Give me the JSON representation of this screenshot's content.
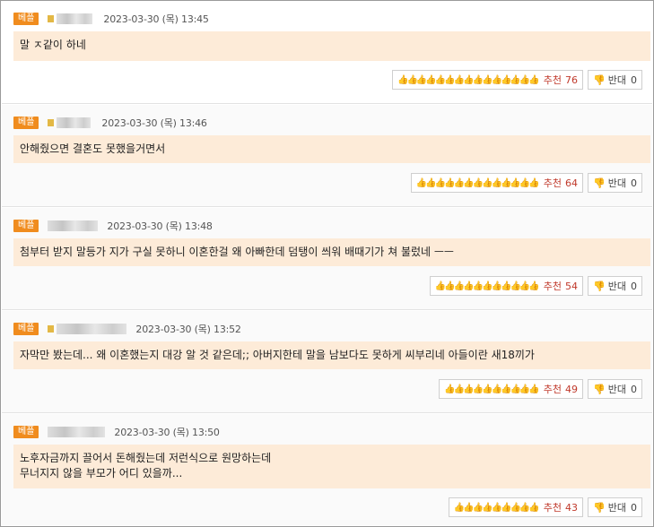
{
  "badge_label": "베플",
  "up_label": "추천",
  "down_label": "반대",
  "thumb_glyphs": {
    "c1": "👍👍👍👍👍👍👍👍👍👍👍👍👍👍👍",
    "c2": "👍👍👍👍👍👍👍👍👍👍👍👍👍",
    "c3": "👍👍👍👍👍👍👍👍👍👍👍",
    "c4": "👍👍👍👍👍👍👍👍👍👍",
    "c5": "👍👍👍👍👍👍👍👍👍"
  },
  "comments": [
    {
      "date": "2023-03-30 (목) 13:45",
      "text_lines": [
        "말 ㅈ같이 하네"
      ],
      "up": "76",
      "down": "0"
    },
    {
      "date": "2023-03-30 (목) 13:46",
      "text_lines": [
        "안해줬으면 결혼도 못했을거면서"
      ],
      "up": "64",
      "down": "0"
    },
    {
      "date": "2023-03-30 (목) 13:48",
      "text_lines": [
        "첨부터 받지 말등가 지가 구실 못하니 이혼한걸 왜 아빠한데 덤탱이 씌워 배때기가 쳐 불렀네 ㅡㅡ"
      ],
      "up": "54",
      "down": "0"
    },
    {
      "date": "2023-03-30 (목) 13:52",
      "text_lines": [
        "자막만 봤는데... 왜 이혼했는지 대강 알 것 같은데;; 아버지한테 말을 남보다도 못하게 씨부리네 아들이란 새18끼가"
      ],
      "up": "49",
      "down": "0"
    },
    {
      "date": "2023-03-30 (목) 13:50",
      "text_lines": [
        "노후자금까지 끌어서 돈해줬는데 저런식으로 원망하는데",
        "무너지지 않을 부모가 어디 있을까..."
      ],
      "up": "43",
      "down": "0"
    }
  ]
}
